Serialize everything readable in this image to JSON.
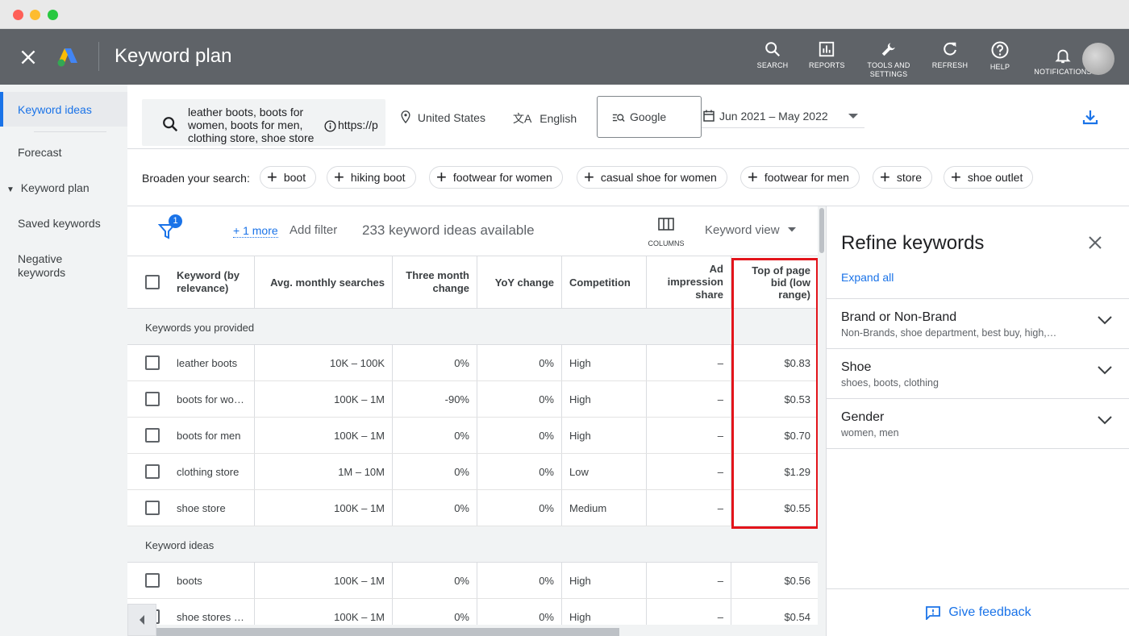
{
  "app": {
    "title": "Keyword plan",
    "tools": [
      {
        "label": "SEARCH",
        "icon": "search-icon"
      },
      {
        "label": "REPORTS",
        "icon": "reports-icon"
      },
      {
        "label": "TOOLS AND SETTINGS",
        "icon": "wrench-icon"
      },
      {
        "label": "REFRESH",
        "icon": "refresh-icon"
      },
      {
        "label": "HELP",
        "icon": "help-icon"
      },
      {
        "label": "NOTIFICATIONS",
        "icon": "bell-icon"
      }
    ]
  },
  "sidebar": {
    "items": [
      {
        "label": "Keyword ideas",
        "active": true
      },
      {
        "label": "Forecast"
      },
      {
        "label": "Keyword plan",
        "expandable": true
      },
      {
        "label": "Saved keywords"
      },
      {
        "label": "Negative keywords"
      }
    ]
  },
  "filters": {
    "search_keywords": "leather boots, boots for women, boots for men, clothing store, shoe store",
    "search_url": "https://p",
    "location": "United States",
    "language": "English",
    "network": "Google",
    "date_range": "Jun 2021 – May 2022"
  },
  "broaden": {
    "label": "Broaden your search:",
    "chips": [
      "boot",
      "hiking boot",
      "footwear for women",
      "casual shoe for women",
      "footwear for men",
      "store",
      "shoe outlet"
    ]
  },
  "toolbar": {
    "filter_count": "1",
    "more_label": "+ 1 more",
    "add_filter": "Add filter",
    "ideas_count": "233 keyword ideas available",
    "columns_label": "COLUMNS",
    "view_label": "Keyword view"
  },
  "table": {
    "headers": [
      "Keyword (by relevance)",
      "Avg. monthly searches",
      "Three month change",
      "YoY change",
      "Competition",
      "Ad impression share",
      "Top of page bid (low range)"
    ],
    "groups": [
      {
        "label": "Keywords you provided",
        "rows": [
          {
            "keyword": "leather boots",
            "searches": "10K – 100K",
            "three_month": "0%",
            "yoy": "0%",
            "competition": "High",
            "impression": "–",
            "bid": "$0.83"
          },
          {
            "keyword": "boots for wo…",
            "searches": "100K – 1M",
            "three_month": "-90%",
            "yoy": "0%",
            "competition": "High",
            "impression": "–",
            "bid": "$0.53"
          },
          {
            "keyword": "boots for men",
            "searches": "100K – 1M",
            "three_month": "0%",
            "yoy": "0%",
            "competition": "High",
            "impression": "–",
            "bid": "$0.70"
          },
          {
            "keyword": "clothing store",
            "searches": "1M – 10M",
            "three_month": "0%",
            "yoy": "0%",
            "competition": "Low",
            "impression": "–",
            "bid": "$1.29"
          },
          {
            "keyword": "shoe store",
            "searches": "100K – 1M",
            "three_month": "0%",
            "yoy": "0%",
            "competition": "Medium",
            "impression": "–",
            "bid": "$0.55"
          }
        ]
      },
      {
        "label": "Keyword ideas",
        "rows": [
          {
            "keyword": "boots",
            "searches": "100K – 1M",
            "three_month": "0%",
            "yoy": "0%",
            "competition": "High",
            "impression": "–",
            "bid": "$0.56"
          },
          {
            "keyword": "shoe stores …",
            "searches": "100K – 1M",
            "three_month": "0%",
            "yoy": "0%",
            "competition": "High",
            "impression": "–",
            "bid": "$0.54"
          }
        ]
      }
    ]
  },
  "refine": {
    "title": "Refine keywords",
    "expand_all": "Expand all",
    "sections": [
      {
        "name": "Brand or Non-Brand",
        "desc": "Non-Brands, shoe department, best buy, high,…"
      },
      {
        "name": "Shoe",
        "desc": "shoes, boots, clothing"
      },
      {
        "name": "Gender",
        "desc": "women, men"
      }
    ],
    "feedback": "Give feedback"
  },
  "colors": {
    "header_bg": "#5f6368",
    "accent": "#1a73e8",
    "highlight": "#e3141b"
  }
}
